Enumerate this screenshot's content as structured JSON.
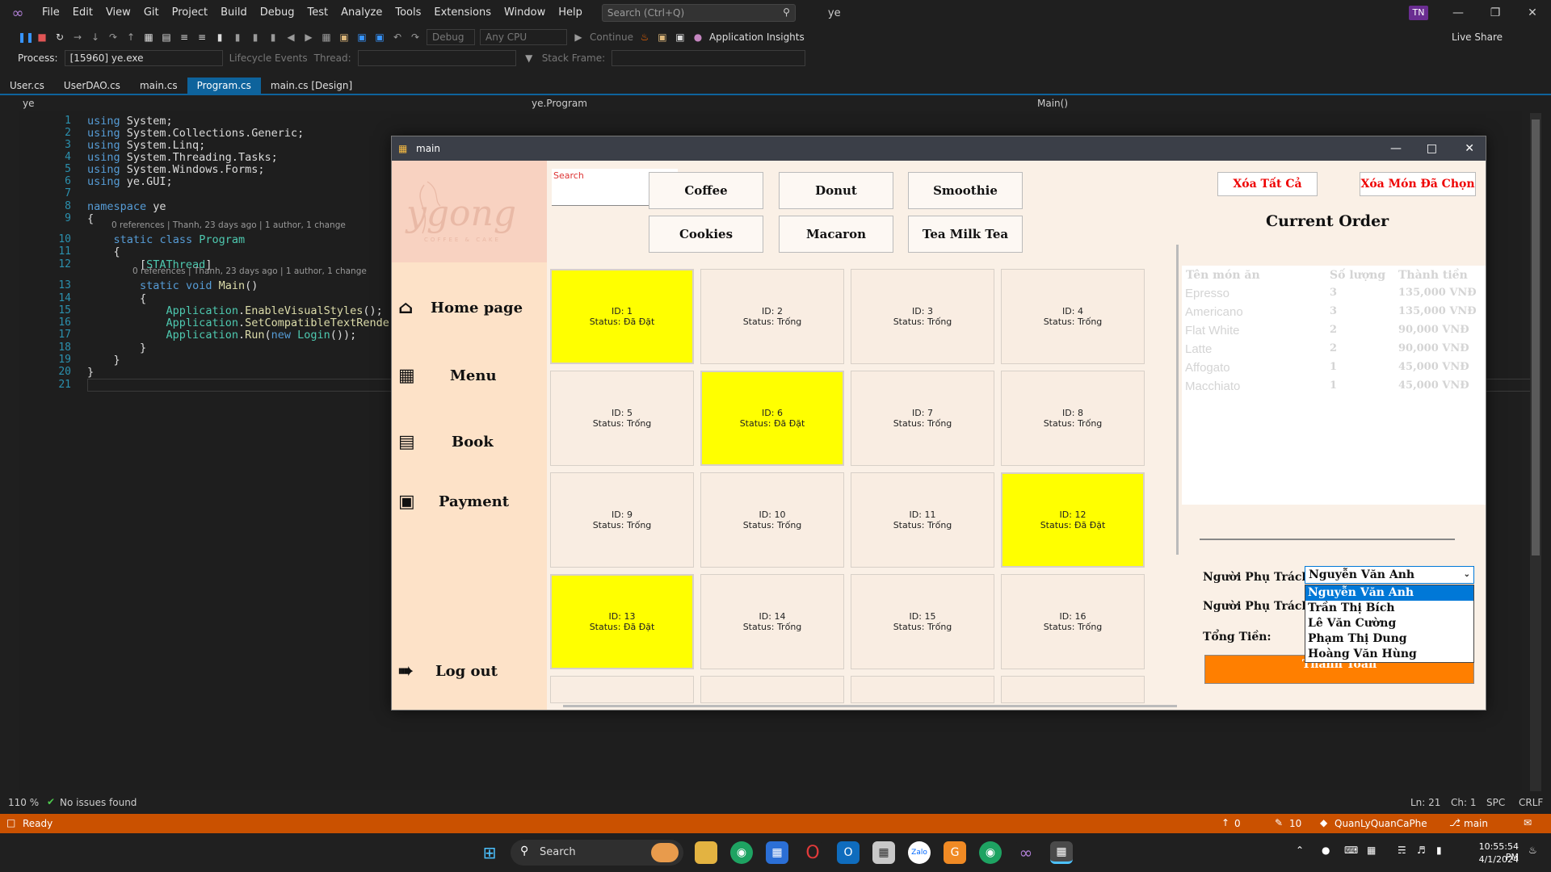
{
  "menubar": {
    "items": [
      "File",
      "Edit",
      "View",
      "Git",
      "Project",
      "Build",
      "Debug",
      "Test",
      "Analyze",
      "Tools",
      "Extensions",
      "Window",
      "Help"
    ],
    "search_placeholder": "Search (Ctrl+Q)",
    "solution_name": "ye",
    "user_initials": "TN"
  },
  "toolbar": {
    "config": "Debug",
    "platform": "Any CPU",
    "continue_label": "Continue",
    "app_insights": "Application Insights",
    "live_share": "Live Share",
    "process_label": "Process:",
    "process_value": "[15960] ye.exe",
    "lifecycle": "Lifecycle Events",
    "thread_label": "Thread:",
    "stack_frame_label": "Stack Frame:"
  },
  "tabs": [
    "User.cs",
    "UserDAO.cs",
    "main.cs",
    "Program.cs",
    "main.cs [Design]"
  ],
  "active_tab": "Program.cs",
  "navbar": {
    "project": "ye",
    "class": "ye.Program",
    "member": "Main()"
  },
  "code": {
    "lines": [
      {
        "n": "1",
        "t": "using System;"
      },
      {
        "n": "2",
        "t": "using System.Collections.Generic;"
      },
      {
        "n": "3",
        "t": "using System.Linq;"
      },
      {
        "n": "4",
        "t": "using System.Threading.Tasks;"
      },
      {
        "n": "5",
        "t": "using System.Windows.Forms;"
      },
      {
        "n": "6",
        "t": "using ye.GUI;"
      },
      {
        "n": "7",
        "t": ""
      },
      {
        "n": "8",
        "t": "namespace ye"
      },
      {
        "n": "9",
        "t": "{"
      },
      {
        "n": "10",
        "t": "    static class Program"
      },
      {
        "n": "11",
        "t": "    {"
      },
      {
        "n": "12",
        "t": "        [STAThread]"
      },
      {
        "n": "13",
        "t": "        static void Main()"
      },
      {
        "n": "14",
        "t": "        {"
      },
      {
        "n": "15",
        "t": "            Application.EnableVisualStyles();"
      },
      {
        "n": "16",
        "t": "            Application.SetCompatibleTextRenderi"
      },
      {
        "n": "17",
        "t": "            Application.Run(new Login());"
      },
      {
        "n": "18",
        "t": "        }"
      },
      {
        "n": "19",
        "t": "    }"
      },
      {
        "n": "20",
        "t": "}"
      },
      {
        "n": "21",
        "t": ""
      }
    ],
    "lens": "0 references | Thanh, 23 days ago | 1 author, 1 change"
  },
  "editor_status": {
    "zoom": "110 %",
    "issues": "No issues found",
    "ln": "Ln: 21",
    "ch": "Ch: 1",
    "spc": "SPC",
    "crlf": "CRLF"
  },
  "statusbar": {
    "ready": "Ready",
    "up": "0",
    "pencil": "10",
    "repo": "QuanLyQuanCaPhe",
    "branch": "main"
  },
  "taskbar": {
    "search": "Search",
    "time": "10:55:54 PM",
    "date": "4/1/2024"
  },
  "app": {
    "title": "main",
    "search_label": "Search",
    "nav": [
      "Home page",
      "Menu",
      "Book",
      "Payment",
      "Log out"
    ],
    "categories": [
      "Coffee",
      "Donut",
      "Smoothie",
      "Cookies",
      "Macaron",
      "Tea  Milk Tea"
    ],
    "tables": [
      {
        "id": "ID: 1",
        "status": "Status: Đã Đặt",
        "booked": true
      },
      {
        "id": "ID: 2",
        "status": "Status: Trống",
        "booked": false
      },
      {
        "id": "ID: 3",
        "status": "Status: Trống",
        "booked": false
      },
      {
        "id": "ID: 4",
        "status": "Status: Trống",
        "booked": false
      },
      {
        "id": "ID: 5",
        "status": "Status: Trống",
        "booked": false
      },
      {
        "id": "ID: 6",
        "status": "Status: Đã Đặt",
        "booked": true
      },
      {
        "id": "ID: 7",
        "status": "Status: Trống",
        "booked": false
      },
      {
        "id": "ID: 8",
        "status": "Status: Trống",
        "booked": false
      },
      {
        "id": "ID: 9",
        "status": "Status: Trống",
        "booked": false
      },
      {
        "id": "ID: 10",
        "status": "Status: Trống",
        "booked": false
      },
      {
        "id": "ID: 11",
        "status": "Status: Trống",
        "booked": false
      },
      {
        "id": "ID: 12",
        "status": "Status: Đã Đặt",
        "booked": true
      },
      {
        "id": "ID: 13",
        "status": "Status: Đã Đặt",
        "booked": true
      },
      {
        "id": "ID: 14",
        "status": "Status: Trống",
        "booked": false
      },
      {
        "id": "ID: 15",
        "status": "Status: Trống",
        "booked": false
      },
      {
        "id": "ID: 16",
        "status": "Status: Trống",
        "booked": false
      }
    ],
    "clear_all": "Xóa Tất Cả",
    "clear_selected": "Xóa Món Đã Chọn",
    "current_order": "Current Order",
    "order_headers": [
      "Tên món ăn",
      "Số lượng",
      "Thành tiền"
    ],
    "order_items": [
      {
        "name": "Epresso",
        "qty": "3",
        "total": "135,000 VNĐ"
      },
      {
        "name": "Americano",
        "qty": "3",
        "total": "135,000 VNĐ"
      },
      {
        "name": "Flat White",
        "qty": "2",
        "total": "90,000 VNĐ"
      },
      {
        "name": "Latte",
        "qty": "2",
        "total": "90,000 VNĐ"
      },
      {
        "name": "Affogato",
        "qty": "1",
        "total": "45,000 VNĐ"
      },
      {
        "name": "Macchiato",
        "qty": "1",
        "total": "45,000 VNĐ"
      }
    ],
    "staff_label": "Người Phụ Trách:",
    "total_label": "Tổng Tiền:",
    "staff_selected": "Nguyễn Văn Anh",
    "staff_options": [
      "Nguyễn Văn Anh",
      "Trần Thị Bích",
      "Lê Văn Cường",
      "Phạm Thị Dung",
      "Hoàng Văn Hùng"
    ],
    "pay_button": "Thanh Toán"
  },
  "colors": {
    "accent": "#0e639c",
    "status_bar": "#ca5100",
    "booked": "#ffff00",
    "pay": "#ff7f00",
    "danger": "#ee0000"
  }
}
